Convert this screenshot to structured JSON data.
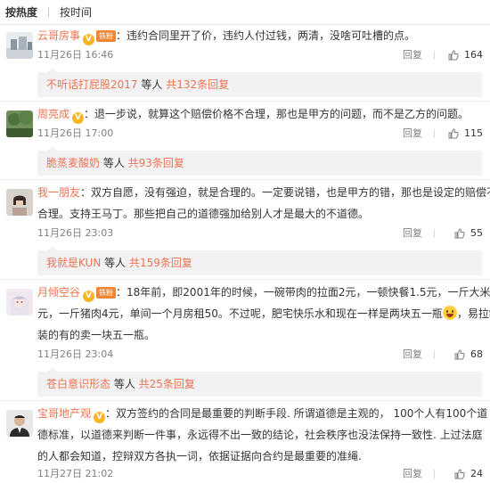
{
  "tabs": {
    "hot": "按热度",
    "time": "按时间"
  },
  "reply_label": "回复",
  "colors": {
    "username": "#eb7350",
    "badge": "#f7b526",
    "fan_badge": "#f08734",
    "subbox_bg": "#f2f2f5"
  },
  "comments": [
    {
      "user": "云哥房事",
      "vip": "V",
      "fan": "铁粉",
      "colon": "：",
      "text": [
        "违约合同里开了价，违约人付过钱，两清，没啥可吐槽的点。"
      ],
      "time": "11月26日 16:46",
      "likes": "164",
      "sub": {
        "who": "不听话打屁股2017",
        "mid": " 等人 ",
        "more": "共132条回复"
      }
    },
    {
      "user": "周亮成",
      "vip": "V",
      "colon": "：",
      "text": [
        "退一步说，就算这个赔偿价格不合理，那也是甲方的问题，而不是乙方的问题。"
      ],
      "time": "11月26日 17:00",
      "likes": "115",
      "sub": {
        "who": "脆蒸麦酸奶",
        "mid": " 等人 ",
        "more": "共93条回复"
      }
    },
    {
      "user": "我一朋友",
      "colon": "：",
      "text": [
        "双方自愿，没有强迫，就是合理的。一定要说错，也是甲方的错，那也是设定的赔偿不",
        "合理。支持王马丁。那些把自己的道德强加给别人才是最大的不道德。"
      ],
      "time": "11月26日 23:03",
      "likes": "55",
      "sub": {
        "who": "我就是KUN",
        "mid": " 等人 ",
        "more": "共159条回复"
      }
    },
    {
      "user": "月倾空谷",
      "vip": "V",
      "fan": "铁粉",
      "colon": "：",
      "text": [
        "18年前，即2001年的时候，一碗带肉的拉面2元，一顿快餐1.5元，一斤大米1",
        "元，一斤猪肉4元，单间一个月房租50。不过呢，肥宅快乐水和现在一样是两块五一瓶",
        "装的有的卖一块五一瓶。"
      ],
      "text2_tail": "，易拉罐",
      "time": "11月26日 23:04",
      "likes": "68",
      "sub": {
        "who": "苍白意识形态",
        "mid": " 等人 ",
        "more": "共25条回复"
      }
    },
    {
      "user": "宝哥地产观",
      "vip": "V",
      "colon": "：",
      "text": [
        "双方签约的合同是最重要的判断手段. 所谓道德是主观的，   100个人有100个道",
        "德标准，以道德来判断一件事，永远得不出一致的结论，社会秩序也没法保持一致性. 上过法庭",
        "的人都会知道，控辩双方各执一词，依据证据向合约是最重要的准绳."
      ],
      "time": "11月27日 21:02",
      "likes": "24"
    }
  ]
}
